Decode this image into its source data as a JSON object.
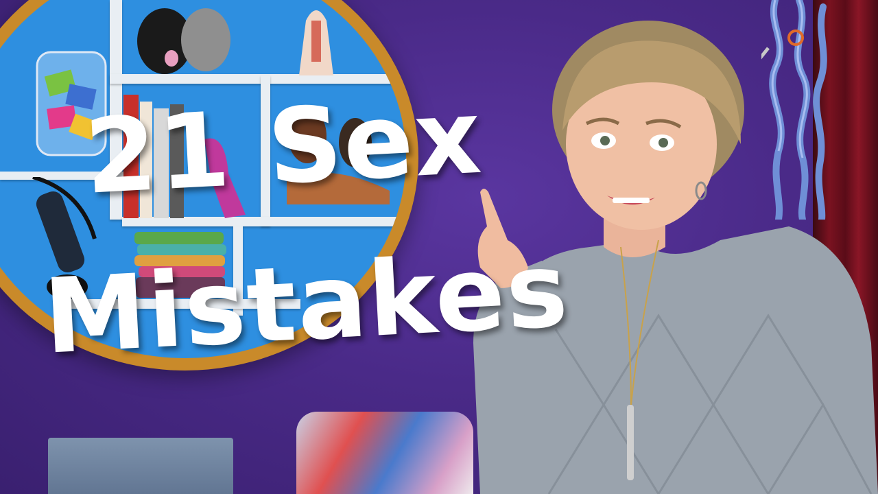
{
  "thumbnail": {
    "title_line1": "21 Sex",
    "title_line2": "Mistakes"
  },
  "colors": {
    "wall": "#4a2a86",
    "shelf_ring": "#c98a2a",
    "shelf_back": "#2e8fe0",
    "title_text": "#ffffff",
    "curtain": "#7a1220",
    "sweater": "#9aa3ad"
  },
  "icons": [
    "pointing-finger"
  ]
}
